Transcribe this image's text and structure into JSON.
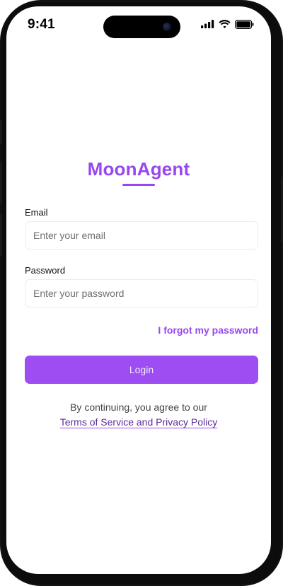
{
  "status_bar": {
    "time": "9:41"
  },
  "icons": {
    "signal": "cellular-signal-icon",
    "wifi": "wifi-icon",
    "battery": "battery-icon"
  },
  "brand": {
    "title": "MoonAgent",
    "accent_color": "#9747f0"
  },
  "form": {
    "email": {
      "label": "Email",
      "placeholder": "Enter your email",
      "value": ""
    },
    "password": {
      "label": "Password",
      "placeholder": "Enter your password",
      "value": ""
    },
    "forgot_password_label": "I forgot my password",
    "login_label": "Login"
  },
  "legal": {
    "prefix": "By continuing, you agree to our",
    "link_label": "Terms of Service and Privacy Policy"
  }
}
